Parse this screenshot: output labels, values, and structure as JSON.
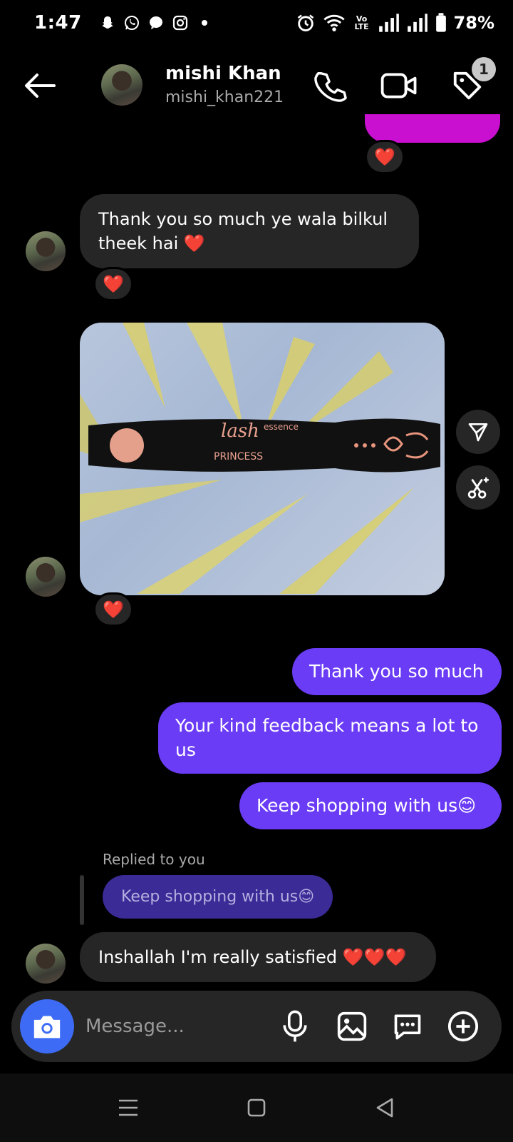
{
  "status_bar": {
    "time": "1:47",
    "battery": "78%",
    "network": "Vo LTE"
  },
  "header": {
    "name": "mishi Khan",
    "username": "mishi_khan221",
    "notification_count": "1"
  },
  "messages": {
    "in_1": "Thank you so much ye wala bilkul theek hai ❤️",
    "reaction_heart": "❤️",
    "out_1": "Thank you so much",
    "out_2": "Your kind feedback means a lot to us",
    "out_3": "Keep shopping with us😊",
    "replied_label": "Replied to you",
    "reply_quote": "Keep shopping with us😊",
    "in_2": "Inshallah I'm really satisfied ❤️❤️❤️"
  },
  "photo": {
    "description_text_brand": "essence",
    "description_text_product": "lash PRINCESS"
  },
  "composer": {
    "placeholder": "Message..."
  },
  "colors": {
    "outgoing_bubble": "#6a3cf6",
    "incoming_bubble": "#262626",
    "camera_button": "#3d6bf5",
    "partial_bubble": "#c90fd0"
  }
}
